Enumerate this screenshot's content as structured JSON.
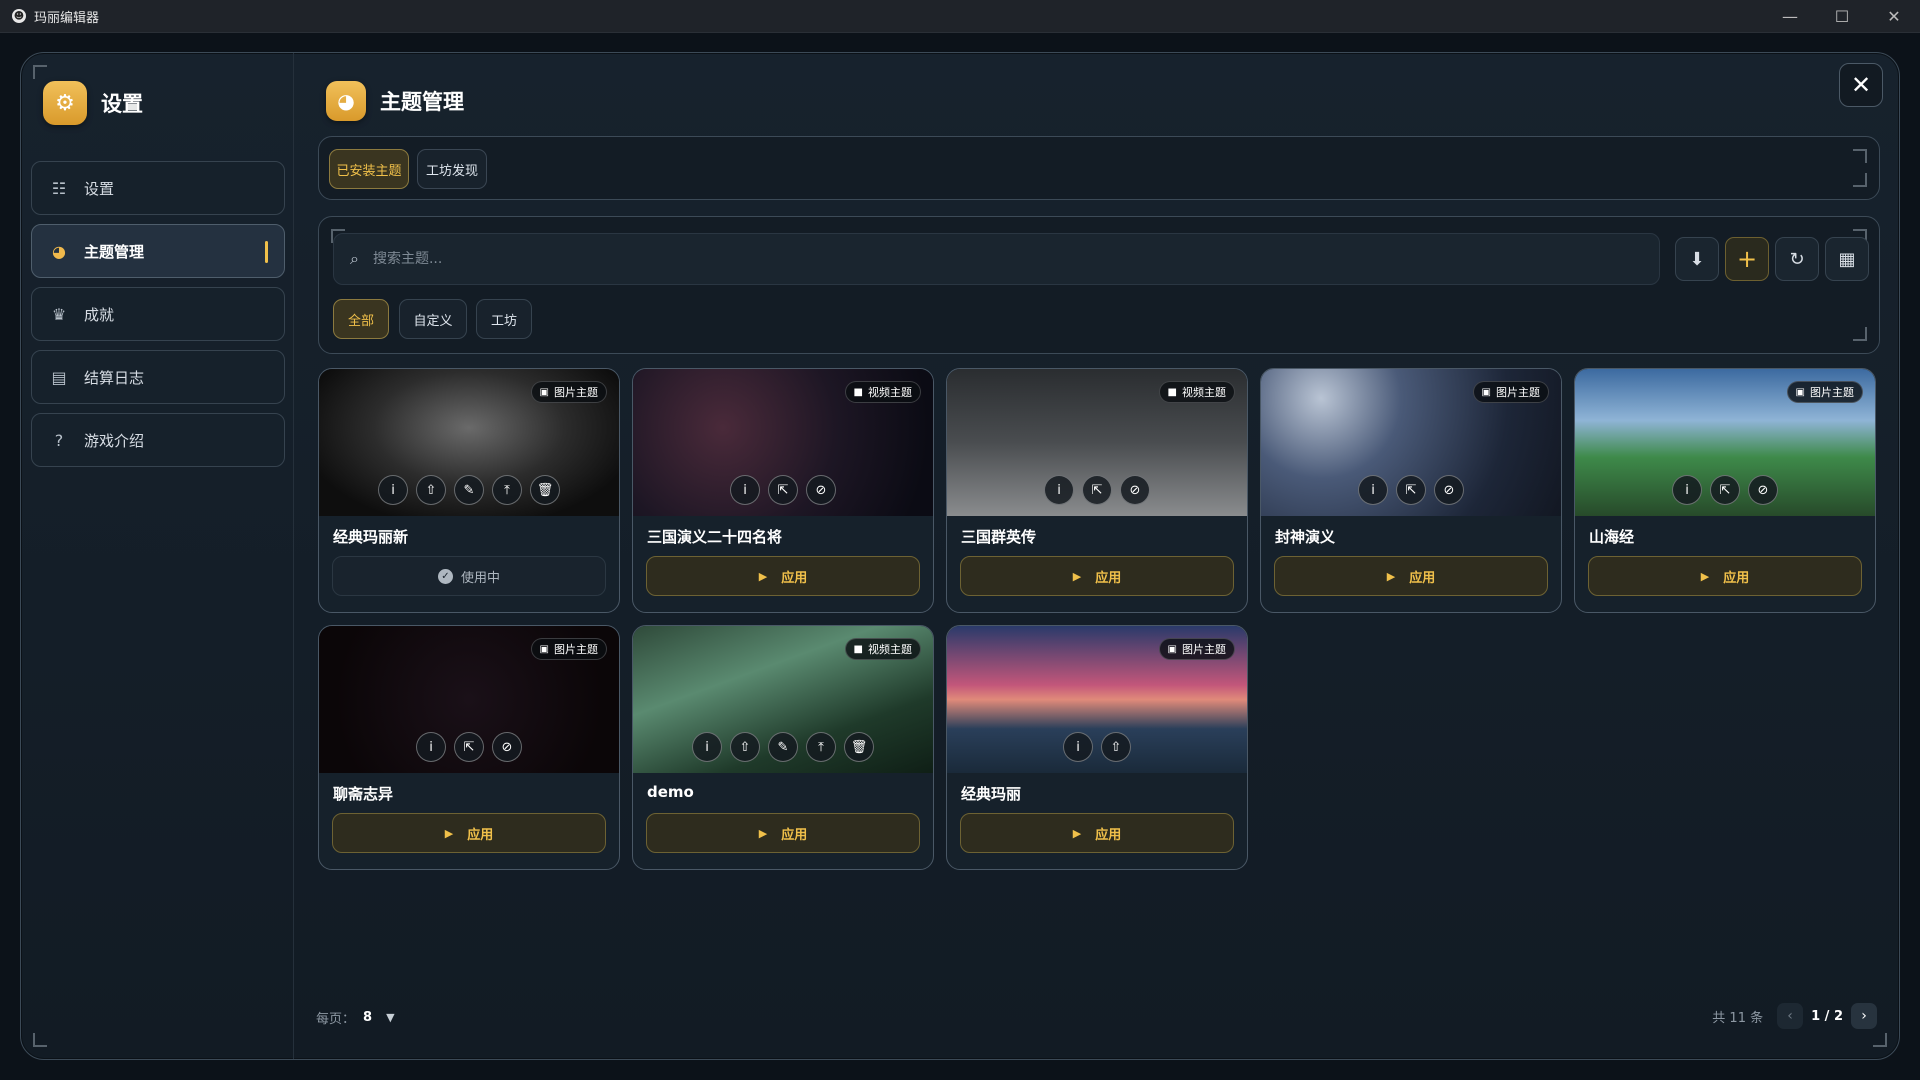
{
  "window": {
    "title": "玛丽编辑器",
    "controls": [
      "—",
      "☐",
      "✕"
    ]
  },
  "sidebar": {
    "title": "设置",
    "items": [
      {
        "icon": "sliders-icon",
        "glyph": "☷",
        "label": "设置"
      },
      {
        "icon": "palette-icon",
        "glyph": "◕",
        "label": "主题管理"
      },
      {
        "icon": "trophy-icon",
        "glyph": "♛",
        "label": "成就"
      },
      {
        "icon": "document-icon",
        "glyph": "▤",
        "label": "结算日志"
      },
      {
        "icon": "help-icon",
        "glyph": "?",
        "label": "游戏介绍"
      }
    ],
    "active_index": 1
  },
  "main": {
    "title": "主题管理",
    "tabs": [
      {
        "label": "已安装主题",
        "active": true
      },
      {
        "label": "工坊发现",
        "active": false
      }
    ],
    "search": {
      "placeholder": "搜索主题..."
    },
    "toolbar": [
      {
        "icon": "download-icon",
        "glyph": "⬇"
      },
      {
        "icon": "plus-icon",
        "glyph": "+"
      },
      {
        "icon": "refresh-icon",
        "glyph": "↻"
      },
      {
        "icon": "store-icon",
        "glyph": "▦"
      }
    ],
    "filters": [
      {
        "label": "全部",
        "active": true
      },
      {
        "label": "自定义",
        "active": false
      },
      {
        "label": "工坊",
        "active": false
      }
    ],
    "cards": [
      {
        "name": "经典玛丽新",
        "type": "图片主题",
        "type_icon": "image-icon",
        "status": "使用中",
        "in_use": true,
        "actions": [
          "info-icon",
          "upload-icon",
          "edit-icon",
          "publish-icon",
          "trash-icon"
        ]
      },
      {
        "name": "三国演义二十四名将",
        "type": "视频主题",
        "type_icon": "video-icon",
        "status": "应用",
        "in_use": false,
        "actions": [
          "info-icon",
          "external-link-icon",
          "unlink-icon"
        ]
      },
      {
        "name": "三国群英传",
        "type": "视频主题",
        "type_icon": "video-icon",
        "status": "应用",
        "in_use": false,
        "actions": [
          "info-icon",
          "external-link-icon",
          "unlink-icon"
        ]
      },
      {
        "name": "封神演义",
        "type": "图片主题",
        "type_icon": "image-icon",
        "status": "应用",
        "in_use": false,
        "actions": [
          "info-icon",
          "external-link-icon",
          "unlink-icon"
        ]
      },
      {
        "name": "山海经",
        "type": "图片主题",
        "type_icon": "image-icon",
        "status": "应用",
        "in_use": false,
        "actions": [
          "info-icon",
          "external-link-icon",
          "unlink-icon"
        ]
      },
      {
        "name": "聊斋志异",
        "type": "图片主题",
        "type_icon": "image-icon",
        "status": "应用",
        "in_use": false,
        "actions": [
          "info-icon",
          "external-link-icon",
          "unlink-icon"
        ]
      },
      {
        "name": "demo",
        "type": "视频主题",
        "type_icon": "video-icon",
        "status": "应用",
        "in_use": false,
        "actions": [
          "info-icon",
          "upload-icon",
          "edit-icon",
          "publish-icon",
          "trash-icon"
        ]
      },
      {
        "name": "经典玛丽",
        "type": "图片主题",
        "type_icon": "image-icon",
        "status": "应用",
        "in_use": false,
        "actions": [
          "info-icon",
          "upload-icon"
        ]
      }
    ],
    "pagination": {
      "per_page_label": "每页：",
      "per_page": "8",
      "total": "共 11 条",
      "page": "1 / 2",
      "prev": "‹",
      "next": "›",
      "dropdown": "▼"
    }
  },
  "colors": {
    "accent": "#f0c04a",
    "panel": "#16212b",
    "border": "#4a5866"
  }
}
